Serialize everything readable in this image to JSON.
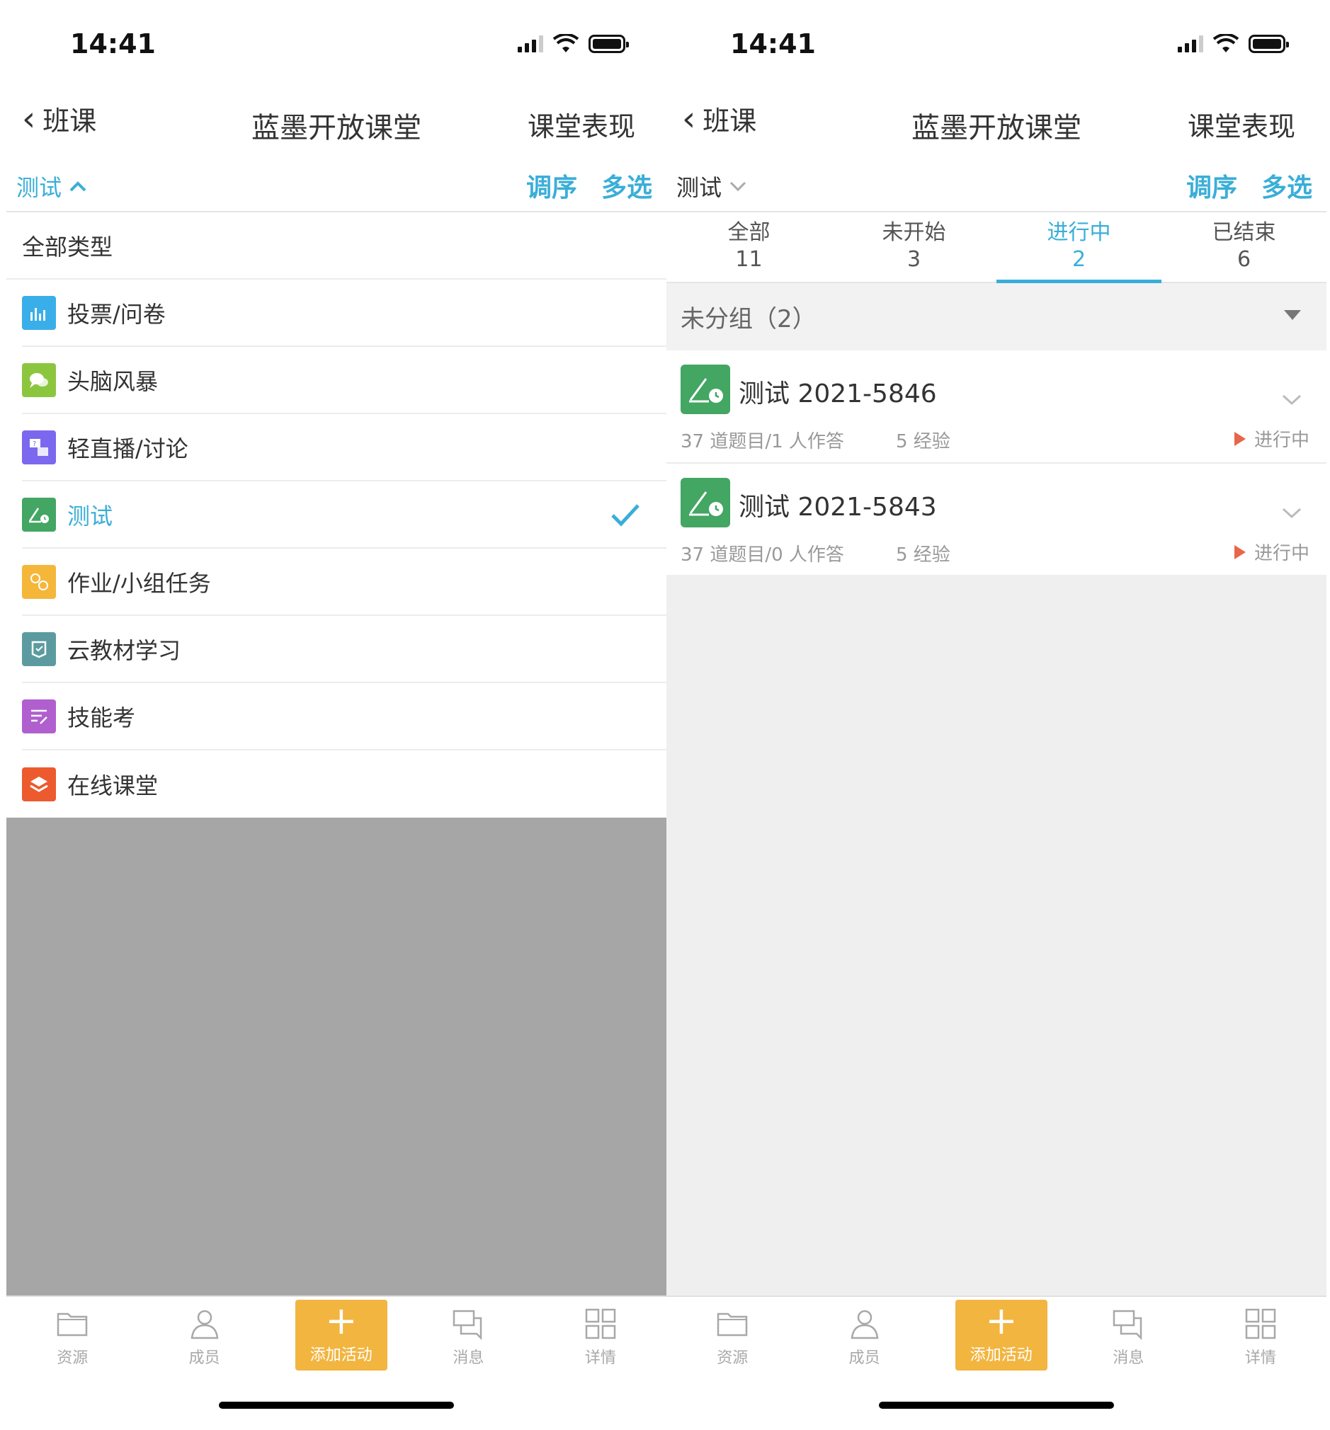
{
  "left": {
    "status": {
      "time": "14:41"
    },
    "nav": {
      "back_label": "班课",
      "title": "蓝墨开放课堂",
      "right_label": "课堂表现"
    },
    "filter": {
      "type_label": "测试",
      "reorder": "调序",
      "multiselect": "多选"
    },
    "types": [
      {
        "label": "全部类型",
        "icon": "none",
        "color": ""
      },
      {
        "label": "投票/问卷",
        "icon": "bar-chart-icon",
        "color": "#3aaee8"
      },
      {
        "label": "头脑风暴",
        "icon": "brainstorm-icon",
        "color": "#8cc63f"
      },
      {
        "label": "轻直播/讨论",
        "icon": "discussion-icon",
        "color": "#7b68ee"
      },
      {
        "label": "测试",
        "icon": "test-icon",
        "color": "#43a663",
        "selected": true
      },
      {
        "label": "作业/小组任务",
        "icon": "homework-icon",
        "color": "#f5b73a"
      },
      {
        "label": "云教材学习",
        "icon": "cloud-book-icon",
        "color": "#5b9ba0"
      },
      {
        "label": "技能考",
        "icon": "skill-exam-icon",
        "color": "#b05fcf"
      },
      {
        "label": "在线课堂",
        "icon": "online-class-icon",
        "color": "#ec5a2e"
      }
    ],
    "tabbar": [
      "资源",
      "成员",
      "添加活动",
      "消息",
      "详情"
    ]
  },
  "right": {
    "status": {
      "time": "14:41"
    },
    "nav": {
      "back_label": "班课",
      "title": "蓝墨开放课堂",
      "right_label": "课堂表现"
    },
    "filter": {
      "type_label": "测试",
      "reorder": "调序",
      "multiselect": "多选"
    },
    "tabs": [
      {
        "label": "全部",
        "count": "11"
      },
      {
        "label": "未开始",
        "count": "3"
      },
      {
        "label": "进行中",
        "count": "2",
        "active": true
      },
      {
        "label": "已结束",
        "count": "6"
      }
    ],
    "group": {
      "label": "未分组（2）"
    },
    "items": [
      {
        "title": "测试 2021-5846",
        "meta": "37 道题目/1 人作答",
        "exp": "5 经验",
        "status": "进行中"
      },
      {
        "title": "测试 2021-5843",
        "meta": "37 道题目/0 人作答",
        "exp": "5 经验",
        "status": "进行中"
      }
    ],
    "tabbar": [
      "资源",
      "成员",
      "添加活动",
      "消息",
      "详情"
    ]
  },
  "colors": {
    "accent": "#3aaed8",
    "add_button": "#f2b540",
    "status_play": "#e8664a"
  }
}
